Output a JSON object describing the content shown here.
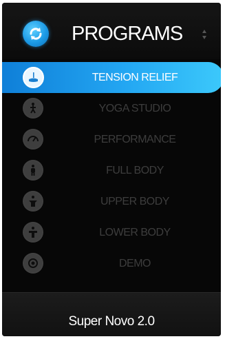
{
  "header": {
    "title": "PROGRAMS",
    "icon": "refresh-icon",
    "scroll_icon": "scroll-arrows-icon"
  },
  "menu": {
    "items": [
      {
        "label": "TENSION RELIEF",
        "icon": "massage-icon",
        "active": true
      },
      {
        "label": "YOGA STUDIO",
        "icon": "yoga-icon",
        "active": false
      },
      {
        "label": "PERFORMANCE",
        "icon": "gauge-icon",
        "active": false
      },
      {
        "label": "FULL BODY",
        "icon": "full-body-icon",
        "active": false
      },
      {
        "label": "UPPER BODY",
        "icon": "upper-body-icon",
        "active": false
      },
      {
        "label": "LOWER BODY",
        "icon": "lower-body-icon",
        "active": false
      },
      {
        "label": "DEMO",
        "icon": "demo-icon",
        "active": false
      }
    ]
  },
  "footer": {
    "model": "Super Novo 2.0"
  },
  "colors": {
    "accent": "#23a6f2",
    "background": "#070707",
    "inactive_text": "#3d3d3d"
  }
}
